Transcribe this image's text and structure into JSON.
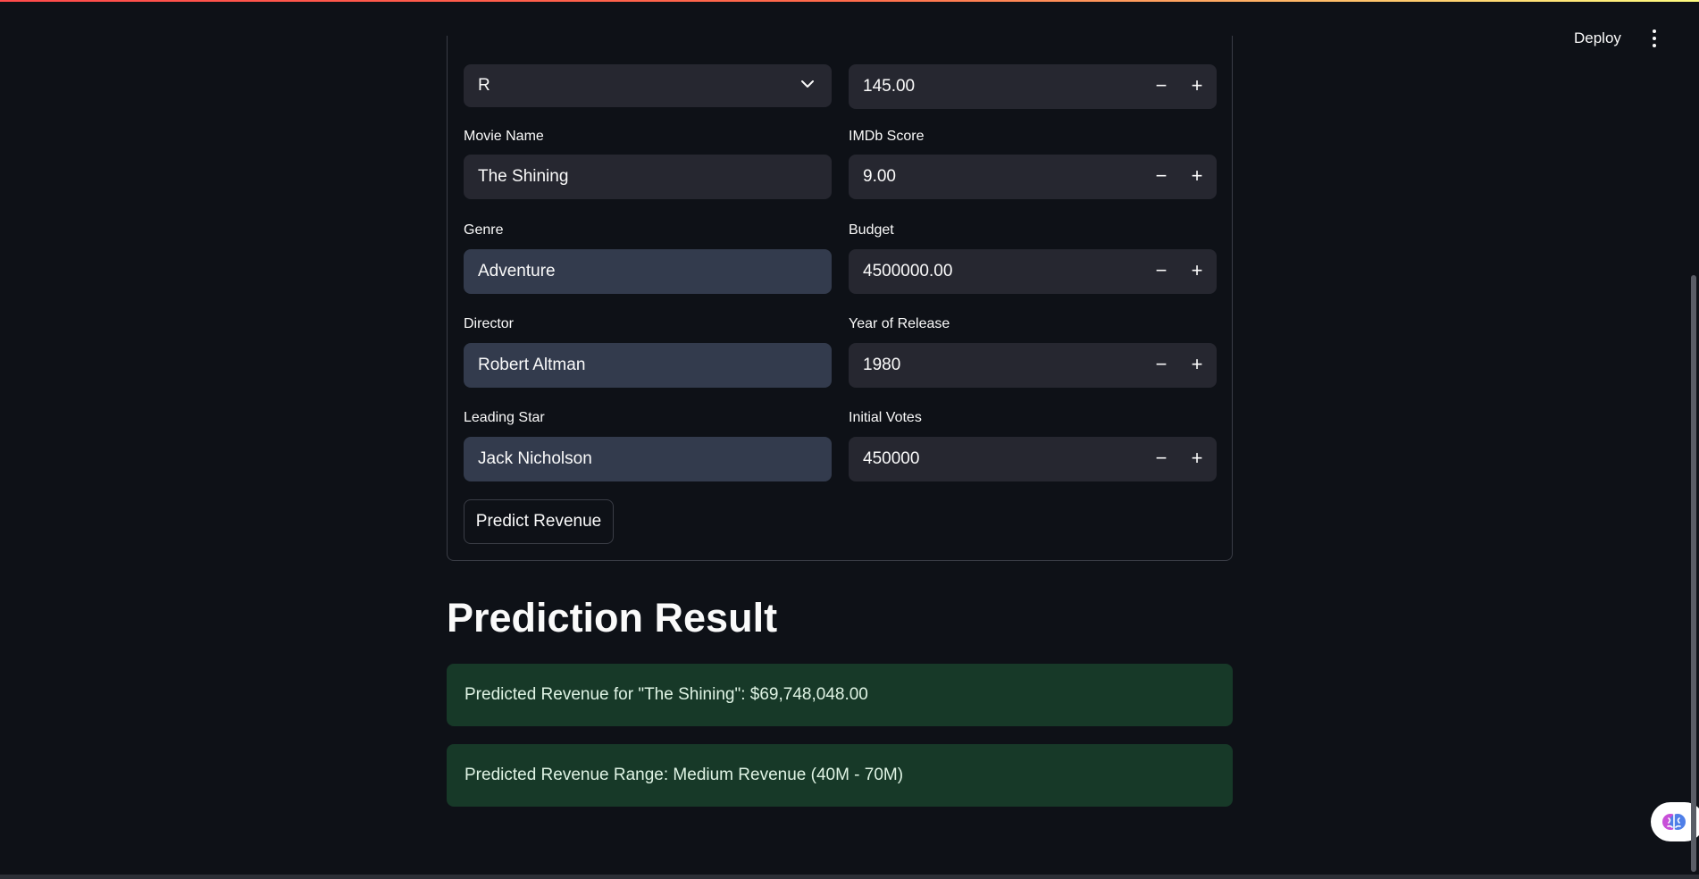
{
  "header": {
    "deploy_label": "Deploy"
  },
  "form": {
    "rating_value": "R",
    "runtime_value": "145.00",
    "movie_name": {
      "label": "Movie Name",
      "value": "The Shining"
    },
    "imdb_score": {
      "label": "IMDb Score",
      "value": "9.00"
    },
    "genre": {
      "label": "Genre",
      "value": "Adventure"
    },
    "budget": {
      "label": "Budget",
      "value": "4500000.00"
    },
    "director": {
      "label": "Director",
      "value": "Robert Altman"
    },
    "year": {
      "label": "Year of Release",
      "value": "1980"
    },
    "leading_star": {
      "label": "Leading Star",
      "value": "Jack Nicholson"
    },
    "initial_votes": {
      "label": "Initial Votes",
      "value": "450000"
    },
    "submit_label": "Predict Revenue",
    "stepper_minus": "−",
    "stepper_plus": "+"
  },
  "result": {
    "heading": "Prediction Result",
    "revenue_text": "Predicted Revenue for \"The Shining\": $69,748,048.00",
    "range_text": "Predicted Revenue Range: Medium Revenue (40M - 70M)"
  },
  "icons": {
    "menu": "kebab-menu-icon",
    "chevron": "chevron-down-icon",
    "assistant": "brain-icon"
  }
}
